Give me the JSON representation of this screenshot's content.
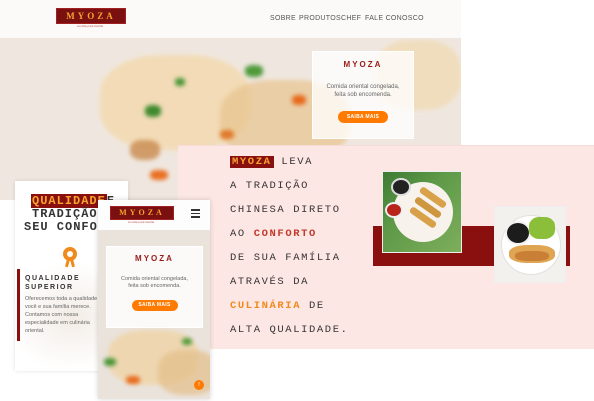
{
  "brand": {
    "name": "MYOZA",
    "tagline": "comida para família"
  },
  "nav": {
    "items": [
      "SOBRE",
      "PRODUTOS",
      "CHEF",
      "FALE CONOSCO"
    ]
  },
  "hero": {
    "card_title": "MYOZA",
    "text_line1": "Comida oriental congelada,",
    "text_line2": "feita sob encomenda.",
    "button": "SAIBA MAIS"
  },
  "about": {
    "brand": "MYOZA",
    "line1_rest": "LEVA",
    "line2": "A TRADIÇÃO",
    "line3": "CHINESA DIRETO",
    "line4_pre": "AO",
    "line4_highlight": "CONFORTO",
    "line5": "DE SUA FAMÍLIA",
    "line6": "ATRAVÉS DA",
    "line7_highlight": "CULINÁRIA",
    "line7_rest": "DE",
    "line8": "ALTA QUALIDADE."
  },
  "tablet": {
    "head_line1_highlight": "QUALIDADE",
    "head_line1_rest": "E",
    "head_line2": "TRADIÇÃO",
    "head_line3": "SEU CONFORTO",
    "section_title_line1": "QUALIDADE",
    "section_title_line2": "SUPERIOR",
    "body_lines": [
      "Oferecemos toda a qualidade",
      "você e sua família merece.",
      "Contamos com nossa",
      "especialidade em culinária",
      "oriental."
    ]
  },
  "mobile": {
    "card_title": "MYOZA",
    "text_line1": "Comida oriental congelada,",
    "text_line2": "feita sob encomenda.",
    "button": "SAIBA MAIS"
  },
  "icons": {
    "menu": "hamburger-menu-icon",
    "award": "award-ribbon-icon",
    "scroll_top": "arrow-up-icon"
  },
  "colors": {
    "brand_dark_red": "#7a1010",
    "brand_gold": "#f4a430",
    "accent_orange": "#ff7a00",
    "section_pink": "#fde7e4"
  }
}
